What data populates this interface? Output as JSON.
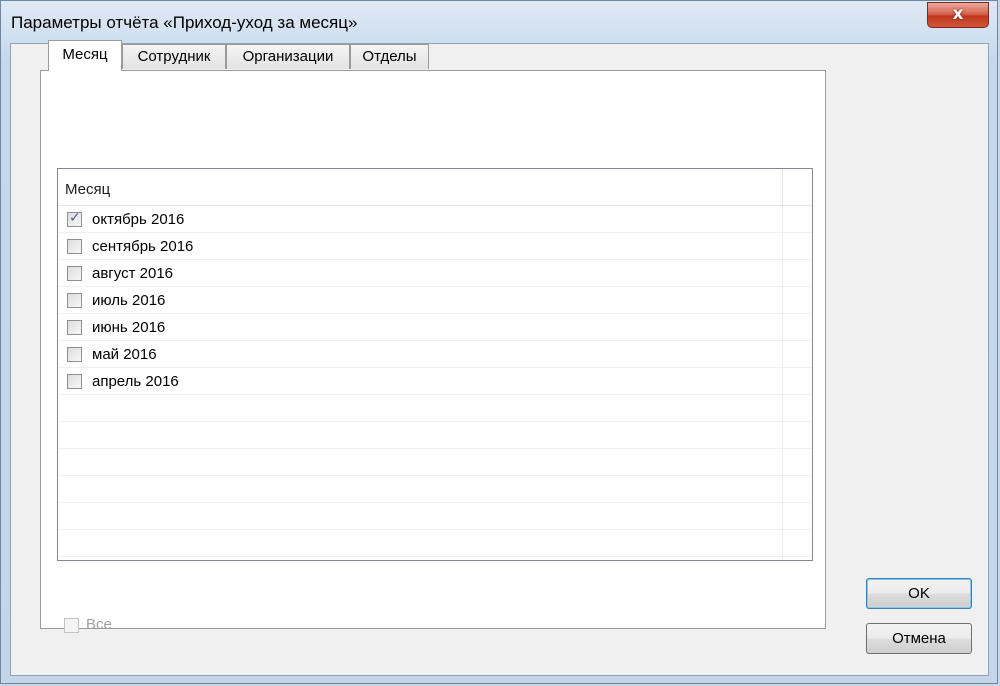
{
  "window": {
    "title": "Параметры отчёта «Приход-уход за месяц»",
    "close_glyph": "x"
  },
  "tabs": [
    {
      "label": "Месяц",
      "active": true
    },
    {
      "label": "Сотрудник",
      "active": false
    },
    {
      "label": "Организации",
      "active": false
    },
    {
      "label": "Отделы",
      "active": false
    }
  ],
  "list": {
    "header": "Месяц",
    "items": [
      {
        "label": "октябрь 2016",
        "checked": true
      },
      {
        "label": "сентябрь 2016",
        "checked": false
      },
      {
        "label": "август 2016",
        "checked": false
      },
      {
        "label": "июль 2016",
        "checked": false
      },
      {
        "label": "июнь 2016",
        "checked": false
      },
      {
        "label": "май 2016",
        "checked": false
      },
      {
        "label": "апрель 2016",
        "checked": false
      }
    ]
  },
  "all_checkbox": {
    "label": "Все",
    "checked": false,
    "enabled": false
  },
  "buttons": {
    "ok": "OK",
    "cancel": "Отмена"
  }
}
